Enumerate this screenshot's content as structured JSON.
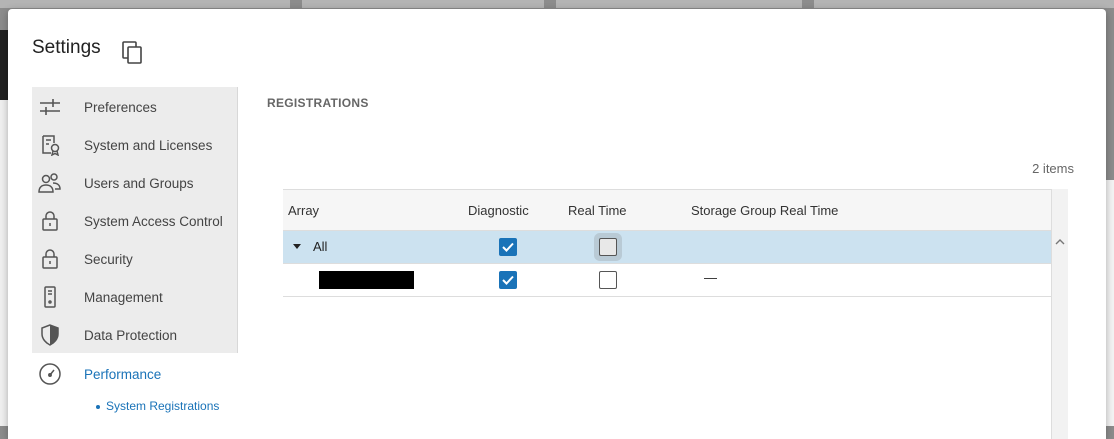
{
  "dialog": {
    "title": "Settings"
  },
  "sidebar": {
    "items": [
      {
        "label": "Preferences",
        "icon": "sliders-icon"
      },
      {
        "label": "System and Licenses",
        "icon": "license-icon"
      },
      {
        "label": "Users and Groups",
        "icon": "users-icon"
      },
      {
        "label": "System Access Control",
        "icon": "lock-icon"
      },
      {
        "label": "Security",
        "icon": "lock-icon"
      },
      {
        "label": "Management",
        "icon": "server-icon"
      },
      {
        "label": "Data Protection",
        "icon": "shield-icon"
      },
      {
        "label": "Performance",
        "icon": "gauge-icon",
        "active": true
      }
    ],
    "sub_items": [
      {
        "label": "System Registrations",
        "active": true
      }
    ]
  },
  "main": {
    "section_title": "REGISTRATIONS",
    "item_count": "2 items",
    "columns": [
      "Array",
      "Diagnostic",
      "Real Time",
      "Storage Group Real Time"
    ],
    "rows": [
      {
        "array": "All",
        "expanded": true,
        "diagnostic": true,
        "real_time": false,
        "storage_group_real_time": "",
        "selected": true
      },
      {
        "array": "",
        "redacted": true,
        "diagnostic": true,
        "real_time": false,
        "storage_group_real_time": "—"
      }
    ]
  },
  "colors": {
    "accent": "#1a73b8",
    "row_selected": "#cce2f0",
    "sidebar_bg": "#ececec"
  }
}
